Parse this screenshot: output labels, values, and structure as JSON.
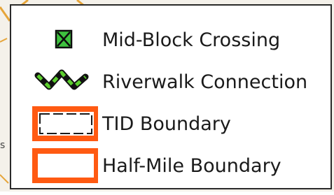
{
  "legend": {
    "items": [
      {
        "label": "Mid-Block Crossing",
        "icon": "crossing-box-icon",
        "color": "#3ec13e"
      },
      {
        "label": "Riverwalk Connection",
        "icon": "zigzag-line-icon",
        "color": "#5ccf2e"
      },
      {
        "label": "TID Boundary",
        "icon": "dashed-rectangle-icon",
        "color": "#ff5a12"
      },
      {
        "label": "Half-Mile Boundary",
        "icon": "solid-rectangle-icon",
        "color": "#ff5a12"
      }
    ]
  },
  "colors": {
    "accent_green": "#3ec13e",
    "accent_orange": "#ff5a12",
    "panel_border": "#2a2a2a"
  }
}
